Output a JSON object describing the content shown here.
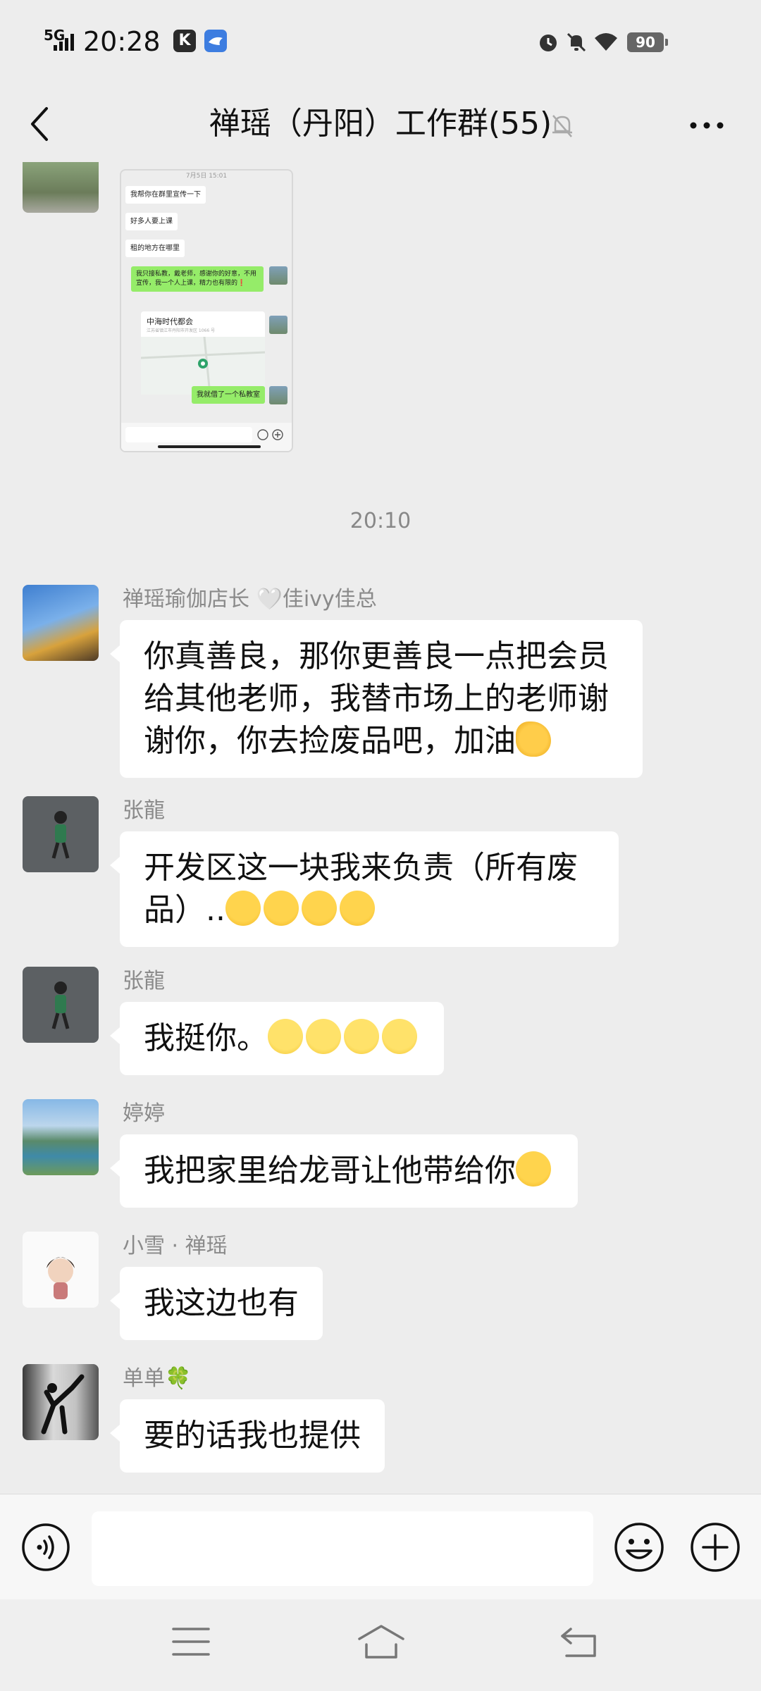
{
  "status_bar": {
    "network": "5G",
    "time": "20:28",
    "app_icon_1": "K",
    "battery": "90",
    "icons": [
      "signal-icon",
      "app-k-icon",
      "app-bird-icon",
      "alarm-icon",
      "mute-icon",
      "wifi-icon",
      "battery-icon"
    ]
  },
  "header": {
    "title": "禅瑶（丹阳）工作群(55)",
    "icons": [
      "back-icon",
      "muted-bell-icon",
      "more-icon"
    ]
  },
  "shared_screenshot": {
    "time": "7月5日 15:01",
    "messages": [
      {
        "text": "我帮你在群里宣传一下",
        "side": "left"
      },
      {
        "text": "好多人要上课",
        "side": "left"
      },
      {
        "text": "租的地方在哪里",
        "side": "left"
      },
      {
        "text": "我只接私教，戴老师，感谢你的好意，不用宣传，我一个人上课，精力也有限的❗",
        "side": "right"
      },
      {
        "text": "我就借了一个私教室",
        "side": "right"
      }
    ],
    "location": {
      "title": "中海时代都会",
      "subtitle": "江苏省镇江市丹阳市开发区 1066 号"
    }
  },
  "timestamp": "20:10",
  "messages": [
    {
      "sender": "禅瑶瑜伽店长 🤍佳ivy佳总",
      "text": "你真善良，那你更善良一点把会员给其他老师，我替市场上的老师谢谢你，你去捡废品吧，加油"
    },
    {
      "sender": "张龍",
      "text": "开发区这一块我来负责（所有废品）.."
    },
    {
      "sender": "张龍",
      "text": "我挺你。"
    },
    {
      "sender": "婷婷",
      "text": "我把家里给龙哥让他带给你"
    },
    {
      "sender": "小雪 · 禅瑶",
      "text": "我这边也有"
    },
    {
      "sender": "单单🍀",
      "text": "要的话我也提供"
    }
  ],
  "input_bar": {
    "icons": [
      "voice-icon",
      "emoji-icon",
      "plus-icon"
    ]
  },
  "system_nav": {
    "icons": [
      "menu-icon",
      "home-icon",
      "back-nav-icon"
    ]
  }
}
